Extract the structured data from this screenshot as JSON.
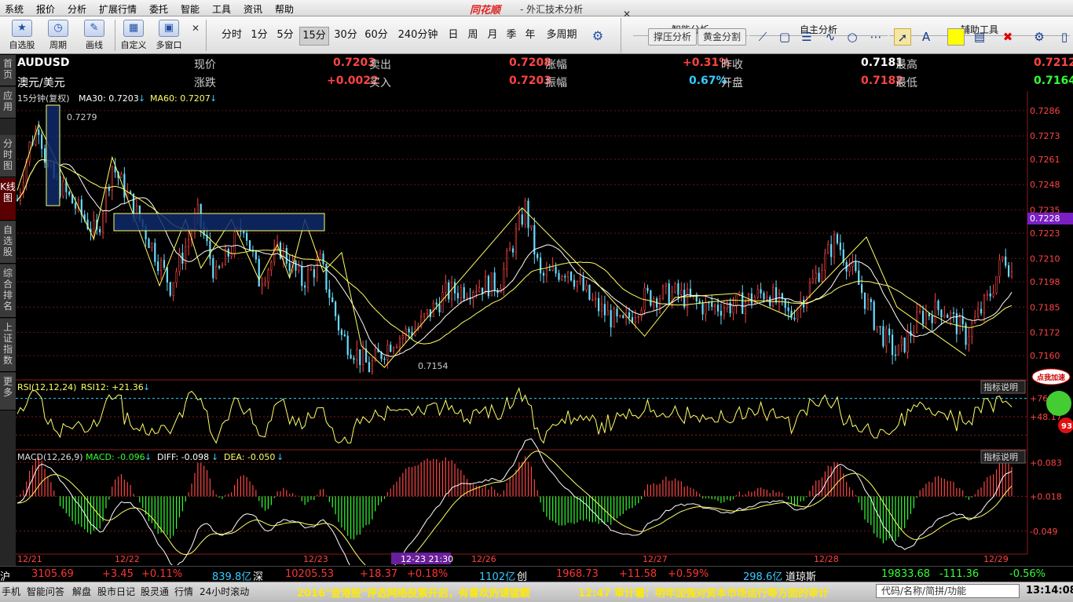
{
  "menu": [
    "系统",
    "报价",
    "分析",
    "扩展行情",
    "委托",
    "智能",
    "工具",
    "资讯",
    "帮助"
  ],
  "brand": "同花顺",
  "window_title": "- 外汇技术分析",
  "toolbar": {
    "buttons": [
      "自选股",
      "周期",
      "画线",
      "自定义",
      "多窗口"
    ],
    "periods": [
      "分时",
      "1分",
      "5分",
      "15分",
      "30分",
      "60分",
      "240分钟",
      "日",
      "周",
      "月",
      "季",
      "年",
      "多周期"
    ],
    "active_period": "15分",
    "smart_analysis": "智能分析",
    "self_analysis": "自主分析",
    "aux_tools": "辅助工具",
    "smart_buttons": [
      "撑压分析",
      "黄金分割"
    ]
  },
  "sidebar": [
    "首页",
    "应用",
    "分时图",
    "K线图",
    "自选股",
    "综合排名",
    "上证指数",
    "更多"
  ],
  "quote": {
    "code": "AUDUSD",
    "name": "澳元/美元",
    "labels": {
      "price": "现价",
      "change": "涨跌",
      "sell": "卖出",
      "buy": "买入",
      "chg_pct": "涨幅",
      "amplitude": "振幅",
      "prev_close": "昨收",
      "open": "开盘",
      "high": "最高",
      "low": "最低"
    },
    "price": "0.7203",
    "change": "+0.0022",
    "sell": "0.7208",
    "buy": "0.7203",
    "chg_pct": "+0.31%",
    "amplitude": "0.67%",
    "prev_close": "0.7181",
    "open": "0.7182",
    "high": "0.7212",
    "low": "0.7164"
  },
  "indicator_line": {
    "period": "15分钟(复权)",
    "ma30": "MA30: 0.7203",
    "ma60": "MA60: 0.7207"
  },
  "price_axis": [
    "0.7286",
    "0.7273",
    "0.7261",
    "0.7248",
    "0.7235",
    "0.7223",
    "0.7210",
    "0.7198",
    "0.7185",
    "0.7172",
    "0.7160"
  ],
  "current_price_tag": "0.7228",
  "annotations": {
    "high": "0.7279",
    "low": "0.7154"
  },
  "rsi": {
    "title": "RSI(12,12,24)",
    "value": "RSI12: +21.36",
    "axis": [
      "+76.4",
      "+48.17"
    ],
    "explain": "指标说明"
  },
  "macd": {
    "title": "MACD(12,26,9)",
    "macd": "MACD: -0.096",
    "diff": "DIFF: -0.098",
    "dea": "DEA: -0.050",
    "axis": [
      "+0.083",
      "+0.018",
      "-0.049"
    ],
    "explain": "指标说明"
  },
  "dates": [
    "12/21",
    "12/22",
    "12/23",
    "12-23 21:30",
    "12/26",
    "12/27",
    "12/28",
    "12/29"
  ],
  "ad_text": "点我加速",
  "ad_num": "93",
  "status": [
    {
      "t": "沪",
      "c": "#ffffff"
    },
    {
      "t": "3105.69",
      "c": "#ff3333"
    },
    {
      "t": "+3.45",
      "c": "#ff3333"
    },
    {
      "t": "+0.11%",
      "c": "#ff3333"
    },
    {
      "t": "839.8亿",
      "c": "#33ccff"
    },
    {
      "t": "深",
      "c": "#ffffff"
    },
    {
      "t": "10205.53",
      "c": "#ff3333"
    },
    {
      "t": "+18.37",
      "c": "#ff3333"
    },
    {
      "t": "+0.18%",
      "c": "#ff3333"
    },
    {
      "t": "1102亿",
      "c": "#33ccff"
    },
    {
      "t": "创",
      "c": "#ffffff"
    },
    {
      "t": "1968.73",
      "c": "#ff3333"
    },
    {
      "t": "+11.58",
      "c": "#ff3333"
    },
    {
      "t": "+0.59%",
      "c": "#ff3333"
    },
    {
      "t": "298.6亿",
      "c": "#33ccff"
    },
    {
      "t": "道琼斯",
      "c": "#ffffff"
    },
    {
      "t": "19833.68",
      "c": "#33ff33"
    },
    {
      "t": "-111.36",
      "c": "#33ff33"
    },
    {
      "t": "-0.56%",
      "c": "#33ff33"
    }
  ],
  "bottom": {
    "items": [
      "手机",
      "智能问答",
      "解盘",
      "股市日记",
      "股灵通",
      "行情",
      "24小时滚动"
    ],
    "news1": "2016\"金港股\"评选网络投票开启，有喜欢的请猛戳",
    "news2": "12:47 审计署：明年加强对资本市场运行等方面的审计",
    "search_placeholder": "代码/名称/简拼/功能",
    "clock": "13:14:08"
  },
  "colors": {
    "up": "#ff4444",
    "down": "#66ddff",
    "ma30": "#ffffff",
    "ma60": "#ffff66",
    "grid": "#5a1a1a"
  }
}
